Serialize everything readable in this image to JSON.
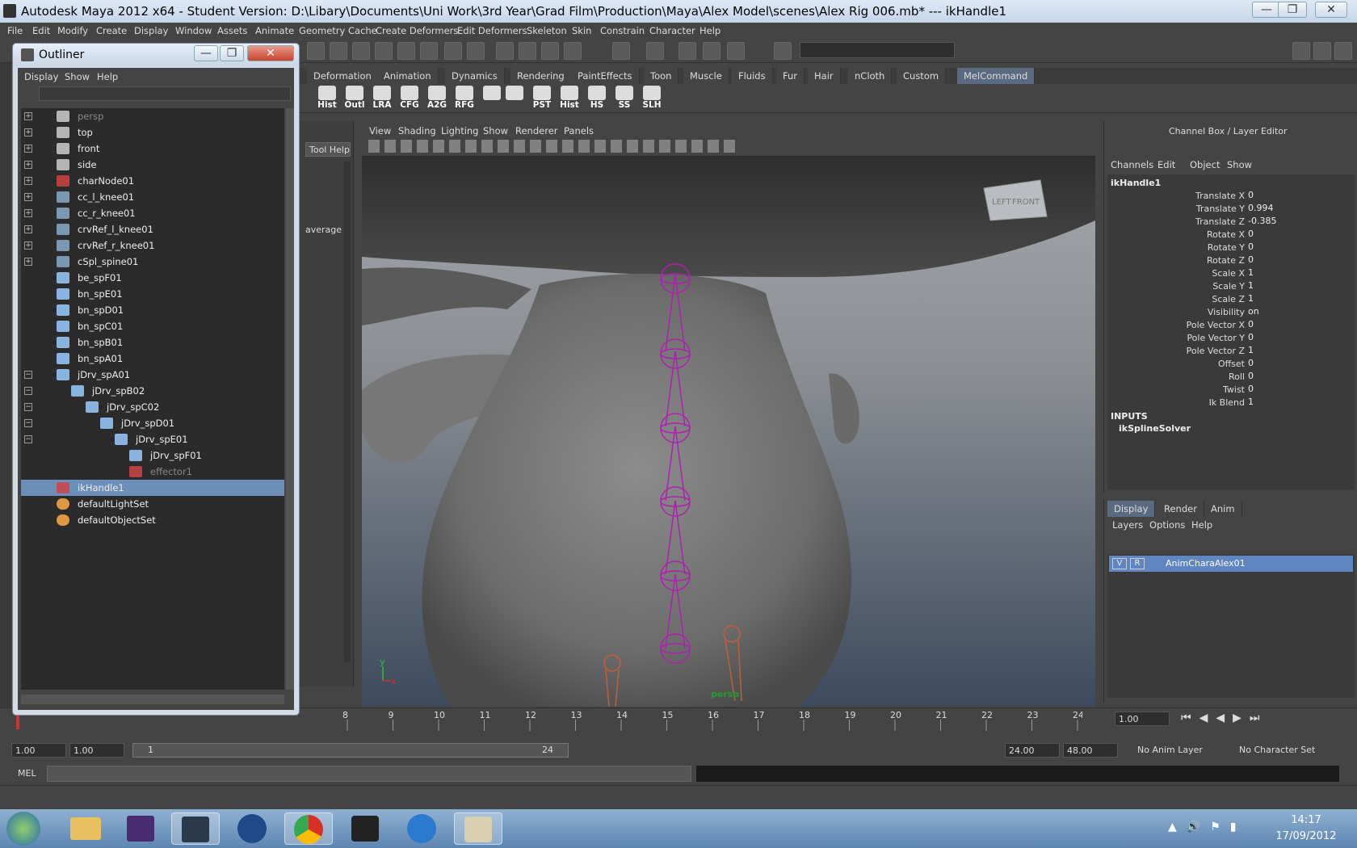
{
  "window": {
    "title": "Autodesk Maya 2012 x64 - Student Version: D:\\Libary\\Documents\\Uni Work\\3rd Year\\Grad Film\\Production\\Maya\\Alex Model\\scenes\\Alex Rig 006.mb*   ---   ikHandle1",
    "min": "—",
    "max": "❐",
    "close": "✕"
  },
  "menubar": [
    "File",
    "Edit",
    "Modify",
    "Create",
    "Display",
    "Window",
    "Assets",
    "Animate",
    "Geometry Cache",
    "Create Deformers",
    "Edit Deformers",
    "Skeleton",
    "Skin",
    "Constrain",
    "Character",
    "Help"
  ],
  "shelf_tabs": [
    "Deformation",
    "Animation",
    "Dynamics",
    "Rendering",
    "PaintEffects",
    "Toon",
    "Muscle",
    "Fluids",
    "Fur",
    "Hair",
    "nCloth",
    "Custom",
    "MelCommand"
  ],
  "shelf_buttons": [
    "Hist",
    "Outl",
    "LRA",
    "CFG",
    "A2G",
    "RFG",
    "PST",
    "Hist",
    "HS",
    "SS",
    "SLH"
  ],
  "attr_panel": {
    "tool_help": "Tool Help",
    "average": "average"
  },
  "viewport": {
    "menu": [
      "View",
      "Shading",
      "Lighting",
      "Show",
      "Renderer",
      "Panels"
    ],
    "camera": "persp",
    "viewcube_left": "LEFT",
    "viewcube_front": "FRONT",
    "axis_y": "y",
    "axis_x": "x"
  },
  "outliner": {
    "title": "Outliner",
    "menu": [
      "Display",
      "Show",
      "Help"
    ],
    "items": [
      {
        "label": "persp",
        "dim": true
      },
      {
        "label": "top"
      },
      {
        "label": "front"
      },
      {
        "label": "side"
      },
      {
        "label": "charNode01"
      },
      {
        "label": "cc_l_knee01"
      },
      {
        "label": "cc_r_knee01"
      },
      {
        "label": "crvRef_l_knee01"
      },
      {
        "label": "crvRef_r_knee01"
      },
      {
        "label": "cSpl_spine01"
      },
      {
        "label": "be_spF01"
      },
      {
        "label": "bn_spE01"
      },
      {
        "label": "bn_spD01"
      },
      {
        "label": "bn_spC01"
      },
      {
        "label": "bn_spB01"
      },
      {
        "label": "bn_spA01"
      },
      {
        "label": "jDrv_spA01"
      },
      {
        "label": "jDrv_spB02"
      },
      {
        "label": "jDrv_spC02"
      },
      {
        "label": "jDrv_spD01"
      },
      {
        "label": "jDrv_spE01"
      },
      {
        "label": "jDrv_spF01"
      },
      {
        "label": "effector1",
        "dim": true
      },
      {
        "label": "ikHandle1",
        "selected": true
      },
      {
        "label": "defaultLightSet"
      },
      {
        "label": "defaultObjectSet"
      }
    ]
  },
  "channelbox": {
    "header": "Channel Box / Layer Editor",
    "menu": [
      "Channels",
      "Edit",
      "Object",
      "Show"
    ],
    "node": "ikHandle1",
    "channels": [
      {
        "name": "Translate X",
        "value": "0"
      },
      {
        "name": "Translate Y",
        "value": "0.994"
      },
      {
        "name": "Translate Z",
        "value": "-0.385"
      },
      {
        "name": "Rotate X",
        "value": "0"
      },
      {
        "name": "Rotate Y",
        "value": "0"
      },
      {
        "name": "Rotate Z",
        "value": "0"
      },
      {
        "name": "Scale X",
        "value": "1"
      },
      {
        "name": "Scale Y",
        "value": "1"
      },
      {
        "name": "Scale Z",
        "value": "1"
      },
      {
        "name": "Visibility",
        "value": "on"
      },
      {
        "name": "Pole Vector X",
        "value": "0"
      },
      {
        "name": "Pole Vector Y",
        "value": "0"
      },
      {
        "name": "Pole Vector Z",
        "value": "1"
      },
      {
        "name": "Offset",
        "value": "0"
      },
      {
        "name": "Roll",
        "value": "0"
      },
      {
        "name": "Twist",
        "value": "0"
      },
      {
        "name": "Ik Blend",
        "value": "1"
      }
    ],
    "inputs_label": "INPUTS",
    "input_node": "ikSplineSolver"
  },
  "layer_editor": {
    "tabs": [
      "Display",
      "Render",
      "Anim"
    ],
    "menu": [
      "Layers",
      "Options",
      "Help"
    ],
    "layer": {
      "v": "V",
      "r": "R",
      "name": "AnimCharaAlex01"
    }
  },
  "timeline": {
    "ticks": [
      "8",
      "9",
      "10",
      "11",
      "12",
      "13",
      "14",
      "15",
      "16",
      "17",
      "18",
      "19",
      "20",
      "21",
      "22",
      "23",
      "24"
    ],
    "current": "1.00",
    "range_start": "1.00",
    "range_start2": "1.00",
    "slider_start": "1",
    "slider_end": "24",
    "range_end": "24.00",
    "anim_end": "48.00",
    "anim_layer": "No Anim Layer",
    "char_set": "No Character Set"
  },
  "cmdline": {
    "label": "MEL"
  },
  "taskbar": {
    "time": "14:17",
    "date": "17/09/2012"
  },
  "colors": {
    "selection": "#6b8fb8",
    "joint": "#b020b0",
    "layer_sel": "#5f86c0"
  }
}
